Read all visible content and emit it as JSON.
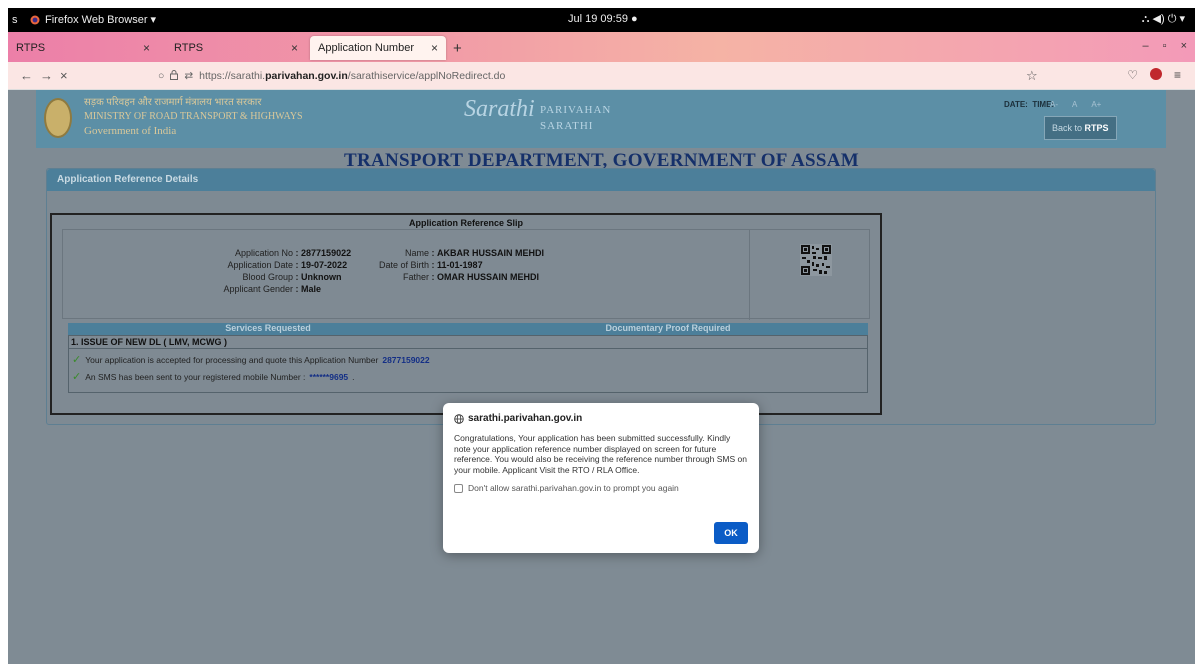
{
  "system_bar": {
    "activities": "s",
    "app_name": "Firefox Web Browser ▾",
    "clock": "Jul 19  09:59  ●",
    "tray": "⛬  ◀)  ⏻  ▾"
  },
  "browser": {
    "tabs": [
      {
        "label": "RTPS",
        "active": false
      },
      {
        "label": "RTPS",
        "active": false
      },
      {
        "label": "Application Number",
        "active": true
      }
    ],
    "tab_close": "×",
    "new_tab": "+",
    "window_controls": {
      "minimize": "–",
      "maximize": "▫",
      "close": "×"
    },
    "nav": {
      "back": "←",
      "forward": "→",
      "reload": "×"
    },
    "url": {
      "prefix": "https://sarathi.",
      "host": "parivahan.gov.in",
      "path": "/sarathiservice/applNoRedirect.do"
    },
    "icons": {
      "shield": "○",
      "lock": "🔒",
      "permissions": "⇄",
      "bookmark": "☆",
      "pocket": "♡",
      "menu": "≡"
    }
  },
  "site_header": {
    "ministry_hindi": "सड़क परिवहन और राजमार्ग मंत्रालय भारत सरकार",
    "ministry_english": "MINISTRY OF ROAD TRANSPORT & HIGHWAYS",
    "government": "Government of India",
    "logo_main": "Sarathi",
    "logo_line1": "PARIVAHAN",
    "logo_line2": "SARATHI",
    "date_label": "DATE:",
    "time_label": "TIME:",
    "font_small": "A-",
    "font_normal": "A",
    "font_large": "A+",
    "back_prefix": "Back to ",
    "back_target": "RTPS"
  },
  "page": {
    "department_title": "TRANSPORT DEPARTMENT, GOVERNMENT OF ASSAM",
    "panel_heading": "Application Reference Details"
  },
  "slip": {
    "title": "Application Reference Slip",
    "application_no_label": "Application No",
    "application_no": "2877159022",
    "application_date_label": "Application Date",
    "application_date": "19-07-2022",
    "blood_group_label": "Blood Group",
    "blood_group": "Unknown",
    "gender_label": "Applicant Gender",
    "gender": "Male",
    "name_label": "Name",
    "name": "AKBAR HUSSAIN MEHDI",
    "dob_label": "Date of Birth",
    "dob": "11-01-1987",
    "father_label": "Father",
    "father": "OMAR HUSSAIN MEHDI",
    "colon": ":",
    "services_header": "Services Requested",
    "documents_header": "Documentary Proof Required",
    "service_item": "1. ISSUE OF NEW DL ( LMV, MCWG )",
    "message1_text": "Your application is accepted for processing and quote this Application Number",
    "message1_number": "2877159022",
    "message2_text": "An SMS has been sent to your registered mobile Number :",
    "message2_number": "******9695",
    "message2_end": "."
  },
  "modal": {
    "host": "sarathi.parivahan.gov.in",
    "message": "Congratulations, Your application has been submitted successfully. Kindly note your application reference number displayed on screen for future reference. You would also be receiving the reference number through SMS on your mobile. Applicant Visit the RTO / RLA Office.",
    "checkbox_label": "Don't allow sarathi.parivahan.gov.in to prompt you again",
    "ok_label": "OK"
  },
  "colors": {
    "header_blue": "#5c8fa6",
    "title_navy": "#15306a",
    "ok_blue": "#0b5cc6",
    "tab_gradient_start": "#ec7fa8"
  }
}
